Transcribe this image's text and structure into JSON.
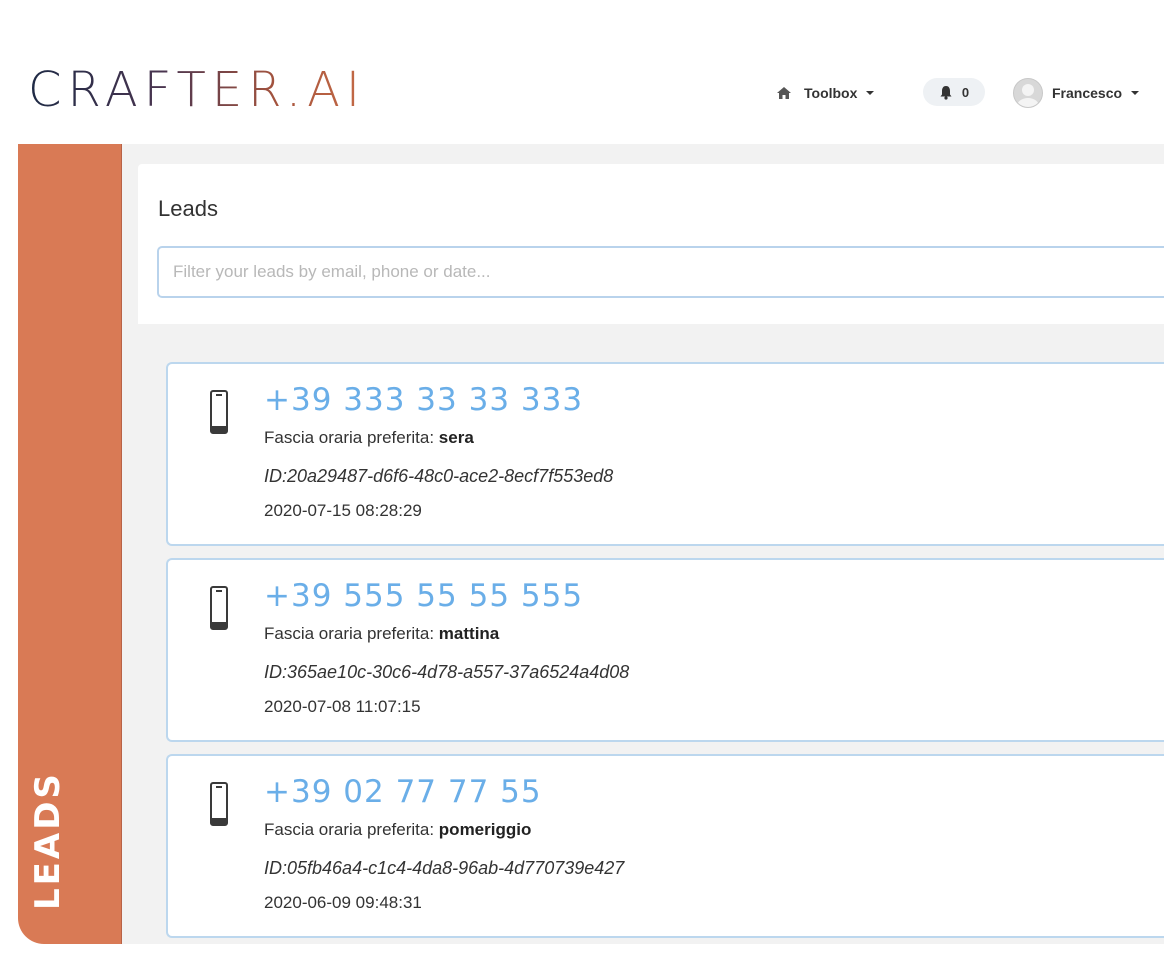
{
  "brand": {
    "logo_text": "CRAFTER.AI"
  },
  "topnav": {
    "toolbox_label": "Toolbox",
    "notifications_count": "0",
    "user_name": "Francesco"
  },
  "sidebar": {
    "section_label": "LEADS"
  },
  "leads_panel": {
    "title": "Leads",
    "filter_placeholder": "Filter your leads by email, phone or date..."
  },
  "leads": [
    {
      "phone": "+39 333 33 33 333",
      "pref_label": "Fascia oraria preferita: ",
      "pref_value": "sera",
      "id": "ID:20a29487-d6f6-48c0-ace2-8ecf7f553ed8",
      "date": "2020-07-15 08:28:29"
    },
    {
      "phone": "+39 555 55 55 555",
      "pref_label": "Fascia oraria preferita: ",
      "pref_value": "mattina",
      "id": "ID:365ae10c-30c6-4d78-a557-37a6524a4d08",
      "date": "2020-07-08 11:07:15"
    },
    {
      "phone": "+39 02 77 77 55",
      "pref_label": "Fascia oraria preferita: ",
      "pref_value": "pomeriggio",
      "id": "ID:05fb46a4-c1c4-4da8-96ab-4d770739e427",
      "date": "2020-06-09 09:48:31"
    }
  ],
  "colors": {
    "sidebar": "#d97a55",
    "phone_link": "#6aaee8",
    "card_border": "#bcd7ee"
  }
}
